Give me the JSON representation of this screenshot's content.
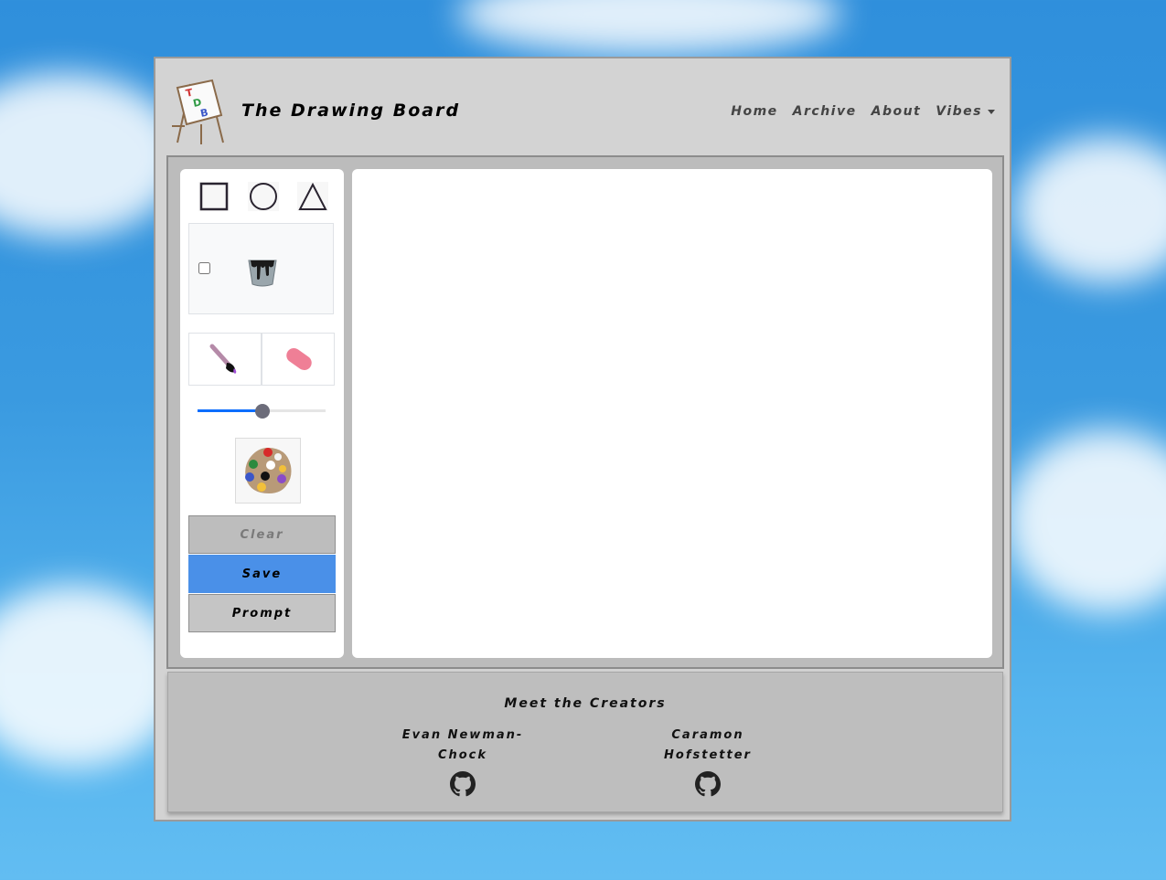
{
  "header": {
    "brand": "The Drawing Board",
    "logo_text": "TDB"
  },
  "nav": [
    {
      "label": "Home"
    },
    {
      "label": "Archive"
    },
    {
      "label": "About"
    },
    {
      "label": "Vibes"
    }
  ],
  "toolbar": {
    "shapes": [
      "square-icon",
      "circle-icon",
      "triangle-icon"
    ],
    "fill_checked": false,
    "tools": [
      "paintbrush-icon",
      "eraser-icon"
    ],
    "brush_size_fraction": 0.51,
    "buttons": {
      "clear": "Clear",
      "save": "Save",
      "prompt": "Prompt"
    }
  },
  "footer": {
    "title": "Meet the Creators",
    "creators": [
      {
        "name_line1": "Evan Newman-",
        "name_line2": "Chock"
      },
      {
        "name_line1": "Caramon",
        "name_line2": "Hofstetter"
      }
    ]
  },
  "colors": {
    "save_button": "#4a90e8",
    "slider_fill": "#0d6efd",
    "frame": "#d3d3d3"
  }
}
